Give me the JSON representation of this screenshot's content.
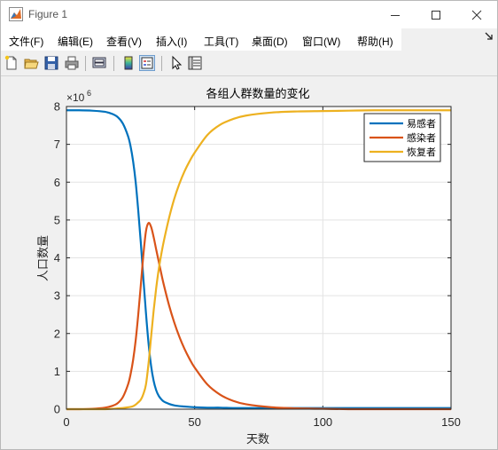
{
  "window": {
    "title": "Figure 1",
    "minimize": "minimize",
    "maximize": "maximize",
    "close": "close"
  },
  "menu": [
    {
      "label": "文件(F)"
    },
    {
      "label": "编辑(E)"
    },
    {
      "label": "查看(V)"
    },
    {
      "label": "插入(I)"
    },
    {
      "label": "工具(T)"
    },
    {
      "label": "桌面(D)"
    },
    {
      "label": "窗口(W)"
    },
    {
      "label": "帮助(H)"
    }
  ],
  "toolbar": [
    "new-figure-icon",
    "open-file-icon",
    "save-icon",
    "print-icon",
    "link-plot-icon",
    "insert-colorbar-icon",
    "insert-legend-icon",
    "edit-plot-icon",
    "property-inspector-icon"
  ],
  "colors": {
    "susceptible": "#0072BD",
    "infected": "#D95319",
    "recovered": "#EDB120"
  },
  "chart_data": {
    "type": "line",
    "title": "各组人群数量的变化",
    "xlabel": "天数",
    "ylabel": "人口数量",
    "exponent_label": "×10",
    "exponent_power": "6",
    "xlim": [
      0,
      150
    ],
    "ylim": [
      0,
      8
    ],
    "xticks": [
      "0",
      "50",
      "100",
      "150"
    ],
    "yticks": [
      "0",
      "1",
      "2",
      "3",
      "4",
      "5",
      "6",
      "7",
      "8"
    ],
    "grid": true,
    "legend_position": "top-right",
    "x": [
      0,
      5,
      10,
      15,
      18,
      20,
      22,
      24,
      25,
      26,
      27,
      28,
      29,
      30,
      31,
      32,
      33,
      34,
      35,
      36,
      37,
      38,
      40,
      42,
      44,
      46,
      48,
      50,
      55,
      60,
      65,
      70,
      80,
      90,
      100,
      110,
      120,
      130,
      140,
      150
    ],
    "series": [
      {
        "name": "易感者",
        "values": [
          7.9,
          7.9,
          7.89,
          7.86,
          7.8,
          7.72,
          7.55,
          7.22,
          6.95,
          6.55,
          6.0,
          5.25,
          4.4,
          3.45,
          2.55,
          1.75,
          1.15,
          0.75,
          0.5,
          0.35,
          0.26,
          0.2,
          0.14,
          0.1,
          0.08,
          0.07,
          0.06,
          0.05,
          0.04,
          0.04,
          0.03,
          0.03,
          0.03,
          0.03,
          0.03,
          0.03,
          0.03,
          0.03,
          0.03,
          0.03
        ]
      },
      {
        "name": "感染者",
        "values": [
          0.0,
          0.0,
          0.01,
          0.04,
          0.09,
          0.16,
          0.32,
          0.65,
          0.92,
          1.3,
          1.82,
          2.5,
          3.28,
          4.08,
          4.7,
          4.92,
          4.82,
          4.55,
          4.22,
          3.9,
          3.58,
          3.28,
          2.75,
          2.3,
          1.92,
          1.6,
          1.33,
          1.1,
          0.65,
          0.38,
          0.22,
          0.13,
          0.05,
          0.02,
          0.01,
          0.0,
          0.0,
          0.0,
          0.0,
          0.0
        ]
      },
      {
        "name": "恢复者",
        "values": [
          0.0,
          0.0,
          0.0,
          0.0,
          0.01,
          0.02,
          0.03,
          0.05,
          0.06,
          0.08,
          0.12,
          0.18,
          0.25,
          0.4,
          0.65,
          1.2,
          1.9,
          2.6,
          3.2,
          3.7,
          4.1,
          4.45,
          5.05,
          5.55,
          5.95,
          6.28,
          6.55,
          6.78,
          7.25,
          7.52,
          7.67,
          7.76,
          7.84,
          7.87,
          7.88,
          7.89,
          7.9,
          7.9,
          7.9,
          7.9
        ]
      }
    ]
  }
}
